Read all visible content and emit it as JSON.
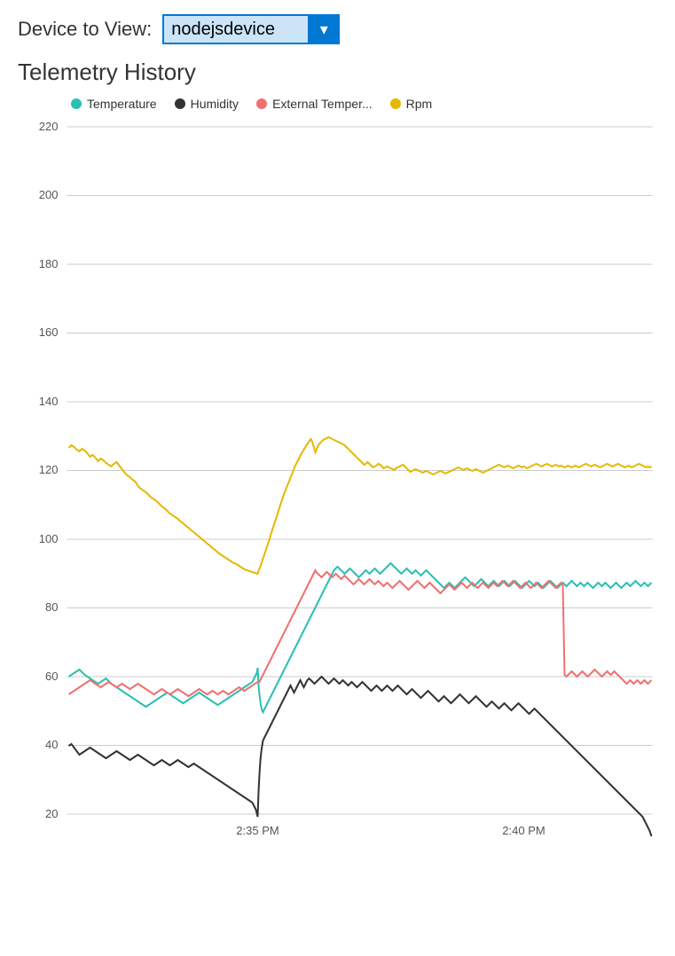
{
  "header": {
    "device_label": "Device to View:",
    "device_value": "nodejsdevice"
  },
  "chart": {
    "title": "Telemetry History",
    "legend": [
      {
        "label": "Temperature",
        "color": "#2bbfb3"
      },
      {
        "label": "Humidity",
        "color": "#333333"
      },
      {
        "label": "External Temper...",
        "color": "#f07070"
      },
      {
        "label": "Rpm",
        "color": "#e6b800"
      }
    ],
    "y_axis": {
      "min": 20,
      "max": 220,
      "ticks": [
        20,
        40,
        60,
        80,
        100,
        120,
        140,
        160,
        180,
        200,
        220
      ]
    },
    "x_axis": {
      "labels": [
        "2:35 PM",
        "2:40 PM"
      ]
    }
  }
}
